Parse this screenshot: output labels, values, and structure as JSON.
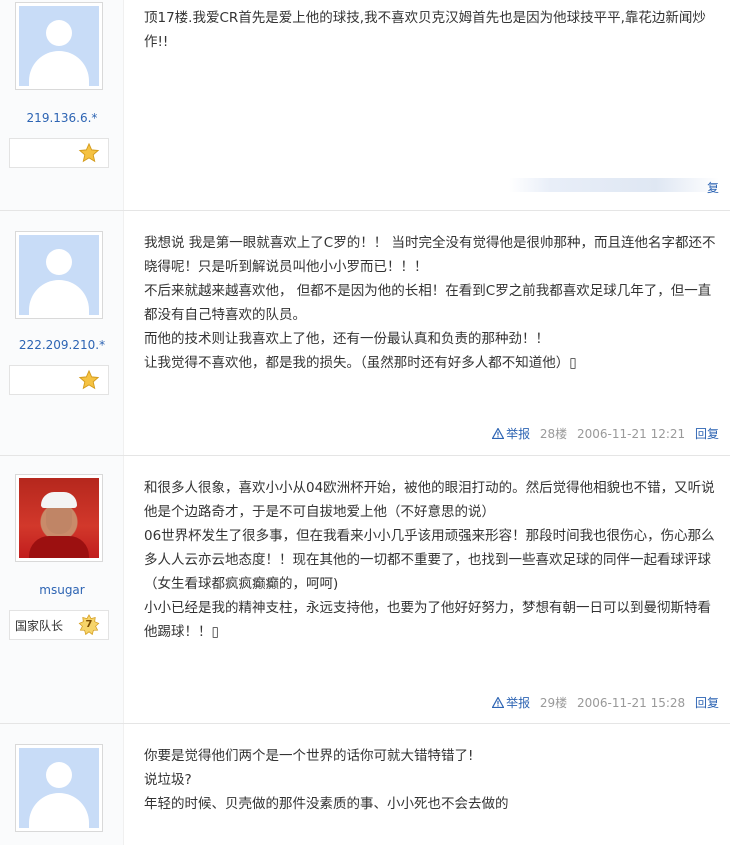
{
  "posts": [
    {
      "username": "219.136.6.*",
      "rank_label": "",
      "rank_icon": "star-icon",
      "paragraphs": [
        "顶17楼.我爱CR首先是爱上他的球技,我不喜欢贝克汉姆首先也是因为他球技平平,靠花边新闻炒作!!"
      ],
      "footer": {
        "reply": "复"
      }
    },
    {
      "username": "222.209.210.*",
      "rank_label": "",
      "rank_icon": "star-icon",
      "paragraphs": [
        "我想说 我是第一眼就喜欢上了C罗的！！ 当时完全没有觉得他是很帅那种，而且连他名字都还不晓得呢！只是听到解说员叫他小小罗而已！！！",
        " 不后来就越来越喜欢他， 但都不是因为他的长相！在看到C罗之前我都喜欢足球几年了，但一直都没有自己特喜欢的队员。",
        " 而他的技术则让我喜欢上了他，还有一份最认真和负责的那种劲！！",
        "让我觉得不喜欢他，都是我的损失。（虽然那时还有好多人都不知道他）▯"
      ],
      "footer": {
        "report": "举报",
        "floor": "28楼",
        "time": "2006-11-21 12:21",
        "reply": "回复"
      }
    },
    {
      "username": "msugar",
      "rank_label": "国家队长",
      "rank_level": "7",
      "paragraphs": [
        "和很多人很象，喜欢小小从04欧洲杯开始，被他的眼泪打动的。然后觉得他相貌也不错，又听说他是个边路奇才，于是不可自拔地爱上他（不好意思的说）",
        "06世界杯发生了很多事，但在我看来小小几乎该用顽强来形容！那段时间我也很伤心，伤心那么多人人云亦云地态度！！现在其他的一切都不重要了，也找到一些喜欢足球的同伴一起看球评球（女生看球都疯疯癫癫的，呵呵)",
        "小小已经是我的精神支柱，永远支持他，也要为了他好好努力，梦想有朝一日可以到曼彻斯特看他踢球！！▯"
      ],
      "footer": {
        "report": "举报",
        "floor": "29楼",
        "time": "2006-11-21 15:28",
        "reply": "回复"
      }
    },
    {
      "username": "",
      "paragraphs": [
        "你要是觉得他们两个是一个世界的话你可就大错特错了!",
        "说垃圾?",
        "年轻的时候、贝壳做的那件没素质的事、小小死也不会去做的"
      ]
    }
  ],
  "colors": {
    "link": "#2d64b3",
    "meta": "#999999",
    "avatar_bg": "#c8dcf7",
    "star": "#f5c242"
  }
}
